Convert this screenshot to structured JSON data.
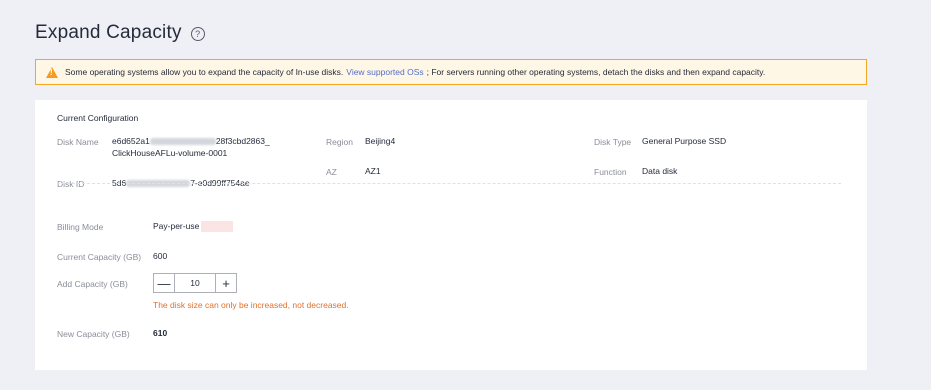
{
  "page": {
    "title": "Expand Capacity",
    "help_icon": "?"
  },
  "notice": {
    "text_before": "Some operating systems allow you to expand the capacity of In-use disks.",
    "link": "View supported OSs",
    "text_after": "; For servers running other operating systems, detach the disks and then expand capacity."
  },
  "config": {
    "section_title": "Current Configuration",
    "disk_name_label": "Disk Name",
    "disk_name_line1_start": "e6d652a1",
    "disk_name_line1_end": "28f3cbd2863_",
    "disk_name_line2": "ClickHouseAFLu-volume-0001",
    "disk_id_label": "Disk ID",
    "disk_id_start": "5d6",
    "disk_id_end": "7-e0d99ff754ae",
    "region_label": "Region",
    "region_value": "Beijing4",
    "az_label": "AZ",
    "az_value": "AZ1",
    "disk_type_label": "Disk Type",
    "disk_type_value": "General Purpose SSD",
    "function_label": "Function",
    "function_value": "Data disk"
  },
  "billing": {
    "label": "Billing Mode",
    "value": "Pay-per-use"
  },
  "current_capacity": {
    "label": "Current Capacity (GB)",
    "value": "600"
  },
  "add_capacity": {
    "label": "Add Capacity (GB)",
    "minus": "—",
    "value": "10",
    "plus": "+",
    "hint": "The disk size can only be increased, not decreased."
  },
  "new_capacity": {
    "label": "New Capacity (GB)",
    "value": "610"
  },
  "colors": {
    "accent": "#526ecc",
    "warning": "#f59a23",
    "hint": "#e0712e"
  }
}
